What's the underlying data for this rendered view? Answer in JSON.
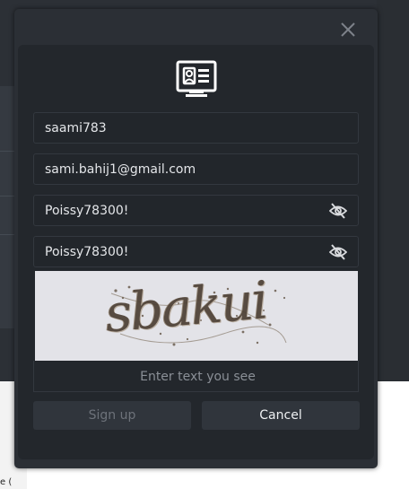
{
  "form": {
    "username_value": "saami783",
    "email_value": "sami.bahij1@gmail.com",
    "password_value": "Poissy78300!",
    "confirm_password_value": "Poissy78300!",
    "captcha_text": "sbakui",
    "captcha_placeholder": "Enter text you see",
    "signup_label": "Sign up",
    "cancel_label": "Cancel"
  },
  "background": {
    "partial_text": "e ("
  },
  "icons": {
    "close": "close-icon",
    "profile": "id-card-monitor-icon",
    "password_eye": "eye-off-icon"
  },
  "colors": {
    "modal_bg": "#2b2f35",
    "panel_bg": "#23272c",
    "field_border": "#33383f",
    "captcha_bg": "#e3e3e8"
  }
}
